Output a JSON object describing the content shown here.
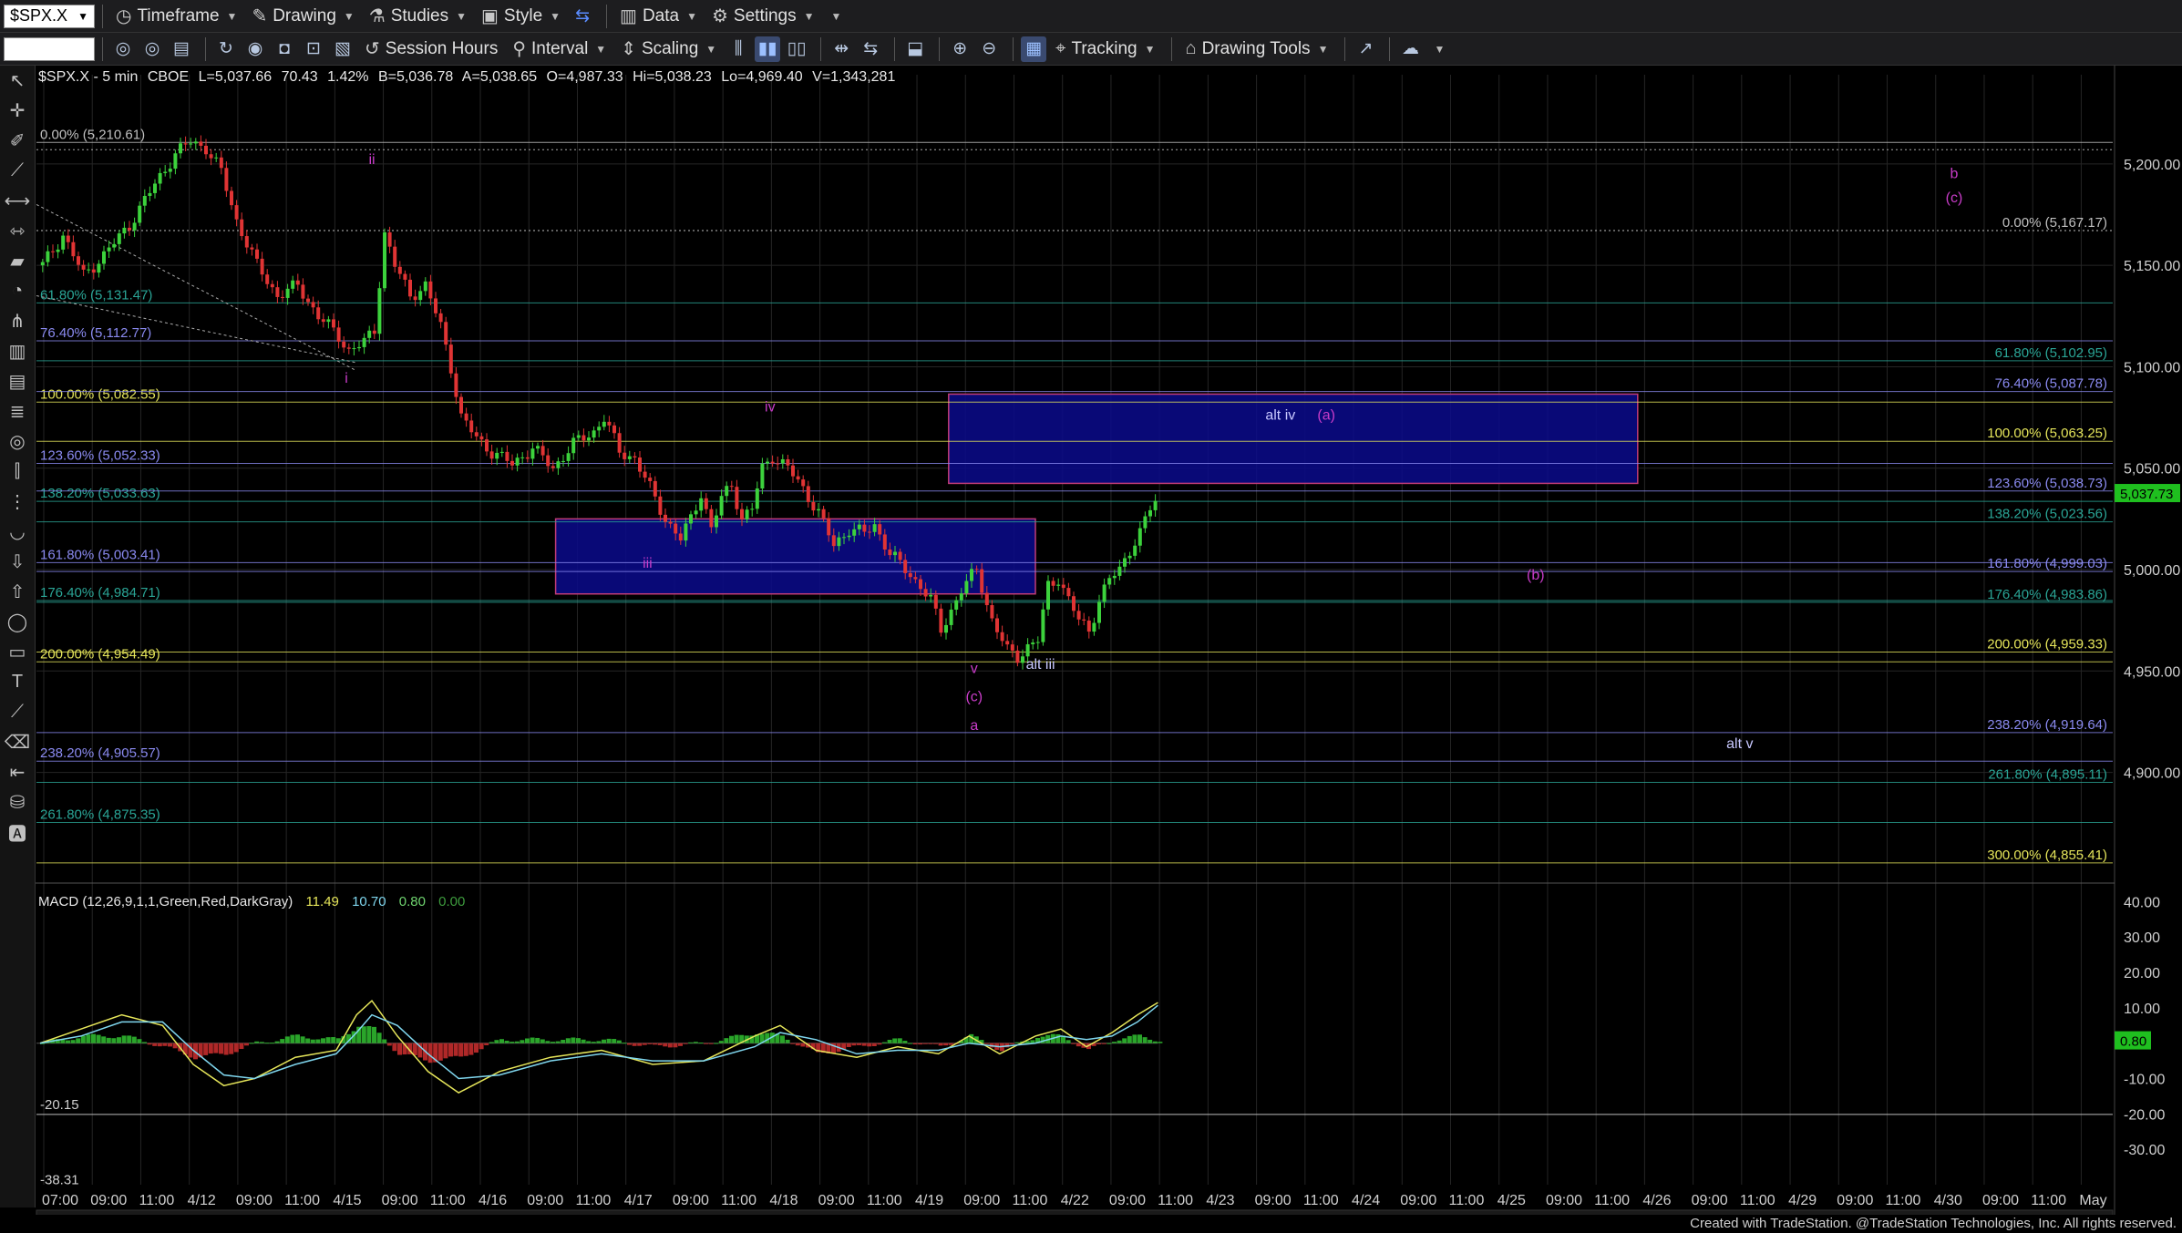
{
  "toolbar": {
    "symbol": "$SPX.X",
    "timeframe": "Timeframe",
    "drawing": "Drawing",
    "studies": "Studies",
    "style": "Style",
    "data": "Data",
    "settings": "Settings",
    "session_hours": "Session Hours",
    "interval": "Interval",
    "scaling": "Scaling",
    "tracking": "Tracking",
    "drawing_tools": "Drawing Tools"
  },
  "header": {
    "symbol_interval": "$SPX.X - 5 min",
    "exchange": "CBOE",
    "last": "L=5,037.66",
    "change": "70.43",
    "change_pct": "1.42%",
    "bid": "B=5,036.78",
    "ask": "A=5,038.65",
    "open": "O=4,987.33",
    "high": "Hi=5,038.23",
    "low": "Lo=4,969.40",
    "volume": "V=1,343,281"
  },
  "macd_header": {
    "label": "MACD (12,26,9,1,1,Green,Red,DarkGray)",
    "v1": "11.49",
    "v2": "10.70",
    "v3": "0.80",
    "v4": "0.00"
  },
  "colors": {
    "macd_v1": "#e6e65a",
    "macd_v2": "#7fd6ee",
    "macd_v3": "#6fd36f",
    "macd_v4": "#3d9b3d",
    "up": "#3cd23c",
    "down": "#e03434",
    "grid": "#252525",
    "zone": "#0a0a8c"
  },
  "footer": "Created with TradeStation. @TradeStation Technologies, Inc. All rights reserved.",
  "chart_data": {
    "type": "line",
    "title": "",
    "price_axis": {
      "ticks": [
        "5,200.00",
        "5,150.00",
        "5,100.00",
        "5,050.00",
        "5,000.00",
        "4,950.00",
        "4,900.00"
      ],
      "range": [
        4845,
        5226
      ]
    },
    "time_axis": [
      "07:00",
      "09:00",
      "11:00",
      "4/12",
      "09:00",
      "11:00",
      "4/15",
      "09:00",
      "11:00",
      "4/16",
      "09:00",
      "11:00",
      "4/17",
      "09:00",
      "11:00",
      "4/18",
      "09:00",
      "11:00",
      "4/19",
      "09:00",
      "11:00",
      "4/22",
      "09:00",
      "11:00",
      "4/23",
      "09:00",
      "11:00",
      "4/24",
      "09:00",
      "11:00",
      "4/25",
      "09:00",
      "11:00",
      "4/26",
      "09:00",
      "11:00",
      "4/29",
      "09:00",
      "11:00",
      "4/30",
      "09:00",
      "11:00",
      "May"
    ],
    "last_price": "5,037.73",
    "price_series": [
      [
        0,
        5150
      ],
      [
        4,
        5165
      ],
      [
        8,
        5145
      ],
      [
        12,
        5155
      ],
      [
        17,
        5170
      ],
      [
        22,
        5190
      ],
      [
        26,
        5205
      ],
      [
        29,
        5211
      ],
      [
        32,
        5208
      ],
      [
        35,
        5196
      ],
      [
        38,
        5172
      ],
      [
        42,
        5150
      ],
      [
        46,
        5135
      ],
      [
        50,
        5140
      ],
      [
        54,
        5125
      ],
      [
        58,
        5115
      ],
      [
        60,
        5108
      ],
      [
        63,
        5112
      ],
      [
        65,
        5118
      ],
      [
        67,
        5166
      ],
      [
        69,
        5150
      ],
      [
        72,
        5135
      ],
      [
        75,
        5140
      ],
      [
        78,
        5120
      ],
      [
        80,
        5100
      ],
      [
        82,
        5075
      ],
      [
        85,
        5065
      ],
      [
        88,
        5058
      ],
      [
        92,
        5052
      ],
      [
        96,
        5060
      ],
      [
        100,
        5050
      ],
      [
        104,
        5062
      ],
      [
        108,
        5068
      ],
      [
        110,
        5075
      ],
      [
        113,
        5058
      ],
      [
        116,
        5055
      ],
      [
        119,
        5040
      ],
      [
        122,
        5025
      ],
      [
        125,
        5015
      ],
      [
        127,
        5025
      ],
      [
        129,
        5038
      ],
      [
        131,
        5020
      ],
      [
        133,
        5035
      ],
      [
        135,
        5042
      ],
      [
        137,
        5025
      ],
      [
        139,
        5030
      ],
      [
        141,
        5050
      ],
      [
        143,
        5056
      ],
      [
        146,
        5050
      ],
      [
        149,
        5040
      ],
      [
        152,
        5028
      ],
      [
        155,
        5012
      ],
      [
        158,
        5020
      ],
      [
        161,
        5018
      ],
      [
        163,
        5022
      ],
      [
        166,
        5008
      ],
      [
        169,
        5000
      ],
      [
        172,
        4992
      ],
      [
        174,
        4985
      ],
      [
        176,
        4970
      ],
      [
        178,
        4980
      ],
      [
        180,
        4990
      ],
      [
        183,
        5000
      ],
      [
        186,
        4975
      ],
      [
        189,
        4960
      ],
      [
        191,
        4957
      ],
      [
        193,
        4962
      ],
      [
        195,
        4965
      ],
      [
        197,
        4992
      ],
      [
        199,
        4996
      ],
      [
        201,
        4985
      ],
      [
        203,
        4975
      ],
      [
        205,
        4970
      ],
      [
        207,
        4985
      ],
      [
        209,
        4995
      ],
      [
        211,
        5000
      ],
      [
        213,
        5010
      ],
      [
        215,
        5018
      ],
      [
        217,
        5030
      ],
      [
        219,
        5037.7
      ]
    ],
    "fib_levels_left": [
      {
        "label": "0.00% (5,210.61)",
        "value": 5210.61,
        "color": "#c0c0c0"
      },
      {
        "label": "61.80% (5,131.47)",
        "value": 5131.47,
        "color": "#2aa596"
      },
      {
        "label": "76.40% (5,112.77)",
        "value": 5112.77,
        "color": "#8a8af0"
      },
      {
        "label": "100.00% (5,082.55)",
        "value": 5082.55,
        "color": "#e4e45a"
      },
      {
        "label": "123.60% (5,052.33)",
        "value": 5052.33,
        "color": "#8a8af0"
      },
      {
        "label": "138.20% (5,033.63)",
        "value": 5033.63,
        "color": "#2aa596"
      },
      {
        "label": "161.80% (5,003.41)",
        "value": 5003.41,
        "color": "#8a8af0"
      },
      {
        "label": "176.40% (4,984.71)",
        "value": 4984.71,
        "color": "#2aa596"
      },
      {
        "label": "200.00% (4,954.49)",
        "value": 4954.49,
        "color": "#e4e45a"
      },
      {
        "label": "238.20% (4,905.57)",
        "value": 4905.57,
        "color": "#8a8af0"
      },
      {
        "label": "261.80% (4,875.35)",
        "value": 4875.35,
        "color": "#2aa596"
      }
    ],
    "fib_levels_right": [
      {
        "label": "0.00% (5,167.17)",
        "value": 5167.17,
        "color": "#c0c0c0"
      },
      {
        "label": "61.80% (5,102.95)",
        "value": 5102.95,
        "color": "#2aa596"
      },
      {
        "label": "76.40% (5,087.78)",
        "value": 5087.78,
        "color": "#8a8af0"
      },
      {
        "label": "100.00% (5,063.25)",
        "value": 5063.25,
        "color": "#e4e45a"
      },
      {
        "label": "123.60% (5,038.73)",
        "value": 5038.73,
        "color": "#8a8af0"
      },
      {
        "label": "138.20% (5,023.56)",
        "value": 5023.56,
        "color": "#2aa596"
      },
      {
        "label": "161.80% (4,999.03)",
        "value": 4999.03,
        "color": "#8a8af0"
      },
      {
        "label": "176.40% (4,983.86)",
        "value": 4983.86,
        "color": "#2aa596"
      },
      {
        "label": "200.00% (4,959.33)",
        "value": 4959.33,
        "color": "#e4e45a"
      },
      {
        "label": "238.20% (4,919.64)",
        "value": 4919.64,
        "color": "#8a8af0"
      },
      {
        "label": "261.80% (4,895.11)",
        "value": 4895.11,
        "color": "#2aa596"
      },
      {
        "label": "300.00% (4,855.41)",
        "value": 4855.41,
        "color": "#e4e45a"
      }
    ],
    "wave_labels": [
      {
        "text": "ii",
        "bar": 65,
        "value": 5200,
        "color": "#c83cc8"
      },
      {
        "text": "i",
        "bar": 60,
        "value": 5092,
        "color": "#c83cc8"
      },
      {
        "text": "iv",
        "bar": 143,
        "value": 5078,
        "color": "#c83cc8"
      },
      {
        "text": "iii",
        "bar": 119,
        "value": 5001,
        "color": "#c83cc8"
      },
      {
        "text": "v",
        "bar": 183,
        "value": 4949,
        "color": "#c83cc8"
      },
      {
        "text": "(c)",
        "bar": 183,
        "value": 4935,
        "color": "#c83cc8"
      },
      {
        "text": "a",
        "bar": 183,
        "value": 4921,
        "color": "#c83cc8"
      },
      {
        "text": "alt iii",
        "bar": 196,
        "value": 4951,
        "color": "#c8c8ff"
      },
      {
        "text": "alt iv",
        "bar": 243,
        "value": 5074,
        "color": "#c8c8ff"
      },
      {
        "text": "(a)",
        "bar": 252,
        "value": 5074,
        "color": "#c83cc8"
      },
      {
        "text": "(b)",
        "bar": 293,
        "value": 4995,
        "color": "#c83cc8"
      },
      {
        "text": "alt v",
        "bar": 333,
        "value": 4912,
        "color": "#c8c8ff"
      },
      {
        "text": "b",
        "bar": 375,
        "value": 5193,
        "color": "#c83cc8"
      },
      {
        "text": "(c)",
        "bar": 375,
        "value": 5181,
        "color": "#c83cc8"
      }
    ],
    "zones": [
      {
        "from_bar": 178,
        "to_bar": 313,
        "high": 5086.5,
        "low": 5042.5
      },
      {
        "from_bar": 101,
        "to_bar": 195,
        "high": 5025,
        "low": 4988
      }
    ],
    "macd": {
      "axis_ticks": [
        "40.00",
        "30.00",
        "20.00",
        "10.00",
        "-10.00",
        "-20.00",
        "-30.00"
      ],
      "range": [
        -40,
        45
      ],
      "current": "0.80",
      "left_labels": [
        "-20.15",
        "-38.31"
      ],
      "reference_level": -20.15,
      "line1": [
        [
          0,
          0
        ],
        [
          8,
          4
        ],
        [
          16,
          8
        ],
        [
          24,
          5
        ],
        [
          30,
          -6
        ],
        [
          36,
          -12
        ],
        [
          42,
          -10
        ],
        [
          50,
          -4
        ],
        [
          58,
          -2
        ],
        [
          62,
          8
        ],
        [
          65,
          12
        ],
        [
          70,
          2
        ],
        [
          76,
          -8
        ],
        [
          82,
          -14
        ],
        [
          90,
          -8
        ],
        [
          100,
          -4
        ],
        [
          110,
          -2
        ],
        [
          120,
          -6
        ],
        [
          130,
          -5
        ],
        [
          140,
          2
        ],
        [
          145,
          5
        ],
        [
          152,
          -2
        ],
        [
          160,
          -4
        ],
        [
          168,
          -1
        ],
        [
          176,
          -3
        ],
        [
          182,
          2
        ],
        [
          188,
          -3
        ],
        [
          195,
          2
        ],
        [
          200,
          4
        ],
        [
          205,
          -1
        ],
        [
          210,
          3
        ],
        [
          215,
          8
        ],
        [
          219,
          11.5
        ]
      ],
      "line2": [
        [
          0,
          0
        ],
        [
          8,
          2
        ],
        [
          16,
          6
        ],
        [
          24,
          6
        ],
        [
          30,
          -2
        ],
        [
          36,
          -9
        ],
        [
          42,
          -10
        ],
        [
          50,
          -6
        ],
        [
          58,
          -3
        ],
        [
          62,
          3
        ],
        [
          65,
          8
        ],
        [
          70,
          5
        ],
        [
          76,
          -3
        ],
        [
          82,
          -10
        ],
        [
          90,
          -9
        ],
        [
          100,
          -5
        ],
        [
          110,
          -3
        ],
        [
          120,
          -5
        ],
        [
          130,
          -5
        ],
        [
          140,
          -1
        ],
        [
          145,
          3
        ],
        [
          152,
          1
        ],
        [
          160,
          -3
        ],
        [
          168,
          -2
        ],
        [
          176,
          -2
        ],
        [
          182,
          0
        ],
        [
          188,
          -1
        ],
        [
          195,
          0
        ],
        [
          200,
          2
        ],
        [
          205,
          1
        ],
        [
          210,
          2
        ],
        [
          215,
          6
        ],
        [
          219,
          10.7
        ]
      ]
    }
  }
}
